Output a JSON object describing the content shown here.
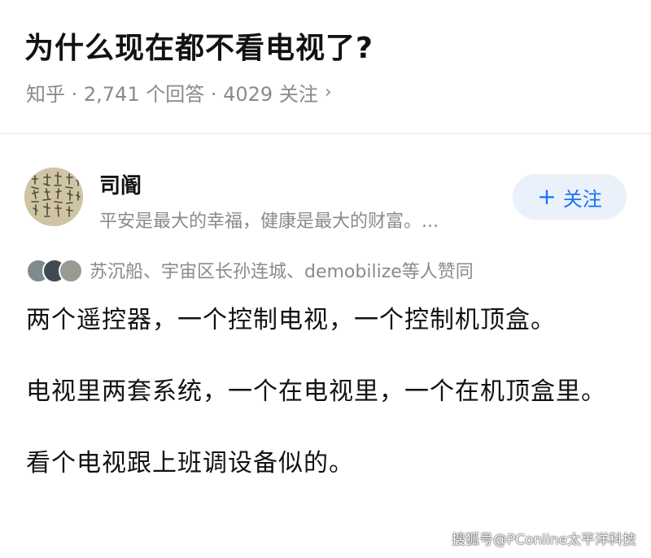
{
  "question": {
    "title": "为什么现在都不看电视了?",
    "meta": "知乎 · 2,741 个回答 · 4029 关注",
    "chevron": "›"
  },
  "author": {
    "name": "司阍",
    "bio": "平安是最大的幸福，健康是最大的财富。...",
    "avatar_icon": "calligraphy-avatar"
  },
  "follow_button": {
    "plus": "+",
    "label": "关注",
    "color": "#1772f6",
    "background": "#eaf1fb"
  },
  "voters": {
    "text": "苏沉船、宇宙区长孙连城、demobilize等人赞同"
  },
  "answer": {
    "paragraphs": [
      "两个遥控器，一个控制电视，一个控制机顶盒。",
      "电视里两套系统，一个在电视里，一个在机顶盒里。",
      "看个电视跟上班调设备似的。"
    ]
  },
  "watermark": "搜狐号@PConline太平洋科技"
}
